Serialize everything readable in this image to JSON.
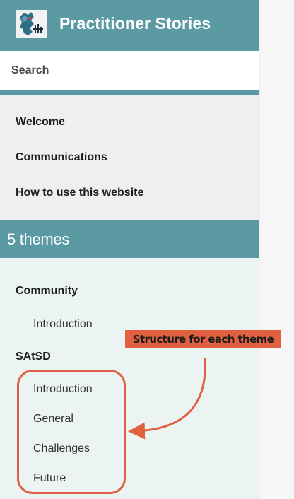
{
  "header": {
    "title": "Practitioner Stories",
    "logo_icon": "logo-icon"
  },
  "search": {
    "placeholder": "Search",
    "value": ""
  },
  "nav": {
    "items": [
      {
        "label": "Welcome"
      },
      {
        "label": "Communications"
      },
      {
        "label": "How to use this website"
      }
    ]
  },
  "themes": {
    "title": "5 themes",
    "groups": [
      {
        "label": "Community",
        "items": [
          {
            "label": "Introduction"
          }
        ]
      },
      {
        "label": "SAtSD",
        "items": [
          {
            "label": "Introduction"
          },
          {
            "label": "General"
          },
          {
            "label": "Challenges"
          },
          {
            "label": "Future"
          }
        ]
      }
    ]
  },
  "annotation": {
    "label": "Structure for each theme",
    "color": "#e0603f"
  },
  "colors": {
    "accent": "#5c9aa3",
    "sidebar_bg": "#ebf3f3",
    "nav_bg": "#efefef"
  }
}
